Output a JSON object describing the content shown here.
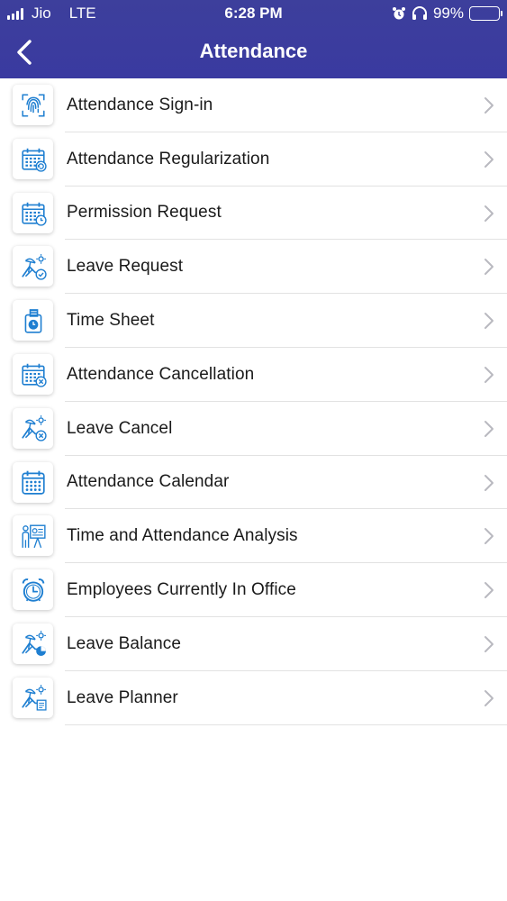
{
  "status_bar": {
    "carrier": "Jio",
    "network": "LTE",
    "time": "6:28 PM",
    "battery": "99%"
  },
  "nav": {
    "title": "Attendance",
    "back_icon": "chevron-left-icon"
  },
  "colors": {
    "header_bg": "#3d3f9c",
    "icon_blue": "#1f7fd1",
    "divider": "#e2e2e2",
    "chevron": "#b9b9c0"
  },
  "menu_items": [
    {
      "label": "Attendance Sign-in",
      "icon": "fingerprint-icon"
    },
    {
      "label": "Attendance Regularization",
      "icon": "calendar-refresh-icon"
    },
    {
      "label": "Permission Request",
      "icon": "calendar-clock-icon"
    },
    {
      "label": "Leave Request",
      "icon": "beach-chair-check-icon"
    },
    {
      "label": "Time Sheet",
      "icon": "timesheet-clock-icon"
    },
    {
      "label": "Attendance Cancellation",
      "icon": "calendar-cancel-icon"
    },
    {
      "label": "Leave Cancel",
      "icon": "beach-chair-cancel-icon"
    },
    {
      "label": "Attendance Calendar",
      "icon": "calendar-icon"
    },
    {
      "label": "Time and Attendance Analysis",
      "icon": "presentation-icon"
    },
    {
      "label": "Employees Currently In Office",
      "icon": "alarm-clock-icon"
    },
    {
      "label": "Leave Balance",
      "icon": "beach-chair-pie-icon"
    },
    {
      "label": "Leave Planner",
      "icon": "beach-chair-planner-icon"
    }
  ]
}
